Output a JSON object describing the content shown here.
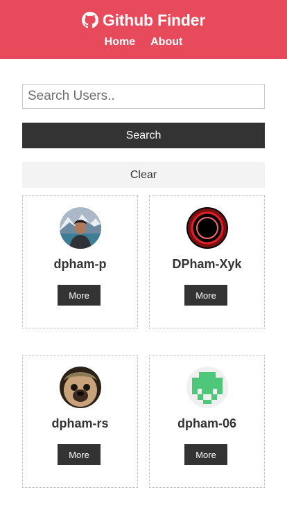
{
  "navbar": {
    "title": "Github Finder",
    "brand_icon": "github-icon",
    "links": [
      {
        "label": "Home"
      },
      {
        "label": "About"
      }
    ],
    "color": "#e64a5b"
  },
  "search": {
    "placeholder": "Search Users..",
    "value": "",
    "button_label": "Search",
    "clear_label": "Clear"
  },
  "users": [
    {
      "login": "dpham-p",
      "more_label": "More",
      "avatar": "photo-avatar-person"
    },
    {
      "login": "DPham-Xyk",
      "more_label": "More",
      "avatar": "red-ring-avatar"
    },
    {
      "login": "dpham-rs",
      "more_label": "More",
      "avatar": "pug-photo-avatar"
    },
    {
      "login": "dpham-06",
      "more_label": "More",
      "avatar": "identicon-avatar"
    }
  ]
}
